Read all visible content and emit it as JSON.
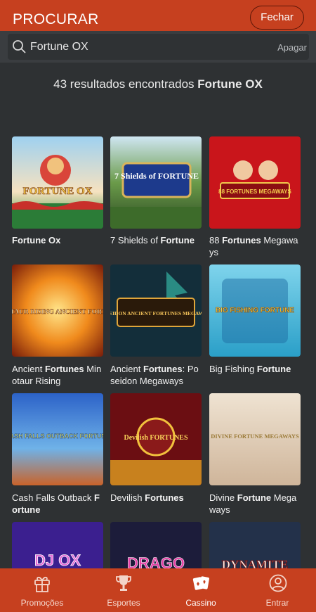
{
  "header": {
    "title": "PROCURAR",
    "close_label": "Fechar"
  },
  "search": {
    "query": "Fortune OX",
    "clear_label": "Apagar"
  },
  "results": {
    "count_text": "43 resultados encontrados",
    "query": "Fortune OX"
  },
  "games": [
    {
      "name": [
        "",
        "Fortune",
        " ",
        "Ox",
        ""
      ],
      "art": "FORTUNE OX"
    },
    {
      "name": [
        "7 Shields of ",
        "Fortune",
        "",
        "",
        ""
      ],
      "art": "7 Shields of FORTUNE"
    },
    {
      "name": [
        "88 ",
        "Fortunes",
        " Megaways",
        "",
        ""
      ],
      "art": "88 FORTUNES MEGAWAYS"
    },
    {
      "name": [
        "Ancient ",
        "Fortunes",
        " Minotaur Rising",
        "",
        ""
      ],
      "art": "MINOTAUR RISING ANCIENT FORTUNES"
    },
    {
      "name": [
        "Ancient ",
        "Fortunes",
        ": Poseidon Megaways",
        "",
        ""
      ],
      "art": "POSEIDON ANCIENT FORTUNES MEGAWAYS"
    },
    {
      "name": [
        "Big Fishing ",
        "Fortune",
        "",
        "",
        ""
      ],
      "art": "BIG FISHING FORTUNE"
    },
    {
      "name": [
        "Cash Falls Outback ",
        "Fortune",
        "",
        "",
        ""
      ],
      "art": "CASH FALLS OUTBACK FORTUNE"
    },
    {
      "name": [
        "Devilish ",
        "Fortunes",
        "",
        "",
        ""
      ],
      "art": "Devilish FORTUNES"
    },
    {
      "name": [
        "Divine ",
        "Fortune",
        " Megaways",
        "",
        ""
      ],
      "art": "DIVINE FORTUNE MEGAWAYS"
    },
    {
      "name": [
        "",
        "",
        "",
        "",
        ""
      ],
      "art": "DJ OX"
    },
    {
      "name": [
        "",
        "",
        "",
        "",
        ""
      ],
      "art": "DRAGO"
    },
    {
      "name": [
        "",
        "",
        "",
        "",
        ""
      ],
      "art": "DYNAMITE"
    }
  ],
  "nav": [
    {
      "label": "Promoções",
      "icon": "gift-icon"
    },
    {
      "label": "Esportes",
      "icon": "trophy-icon"
    },
    {
      "label": "Cassino",
      "icon": "cards-icon"
    },
    {
      "label": "Entrar",
      "icon": "user-icon"
    }
  ],
  "colors": {
    "accent": "#c6401f",
    "background": "#2e3133",
    "search_bg": "#3a3d40"
  }
}
